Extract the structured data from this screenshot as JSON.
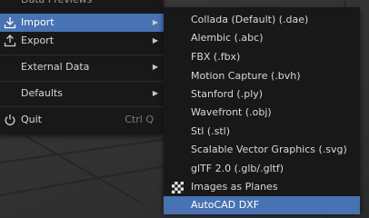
{
  "main_menu": {
    "partial_item": "Data Previews",
    "items": [
      {
        "label": "Import",
        "has_submenu": true,
        "active": true,
        "icon": "import-icon"
      },
      {
        "label": "Export",
        "has_submenu": true,
        "active": false,
        "icon": "export-icon"
      },
      {
        "label": "External Data",
        "has_submenu": true,
        "active": false
      },
      {
        "label": "Defaults",
        "has_submenu": true,
        "active": false
      },
      {
        "label": "Quit",
        "shortcut": "Ctrl Q",
        "icon": "power-icon"
      }
    ]
  },
  "import_submenu": {
    "items": [
      {
        "label": "Collada (Default) (.dae)"
      },
      {
        "label": "Alembic (.abc)"
      },
      {
        "label": "FBX (.fbx)"
      },
      {
        "label": "Motion Capture (.bvh)"
      },
      {
        "label": "Stanford (.ply)"
      },
      {
        "label": "Wavefront (.obj)"
      },
      {
        "label": "Stl (.stl)"
      },
      {
        "label": "Scalable Vector Graphics (.svg)"
      },
      {
        "label": "glTF 2.0 (.glb/.gltf)"
      },
      {
        "label": "Images as Planes",
        "icon": "checkerboard-icon"
      },
      {
        "label": "AutoCAD DXF",
        "active": true
      }
    ]
  },
  "colors": {
    "menu_bg": "#181818",
    "highlight": "#4772b3",
    "text": "#d8d8d8",
    "shortcut_text": "#7a7a7a"
  }
}
